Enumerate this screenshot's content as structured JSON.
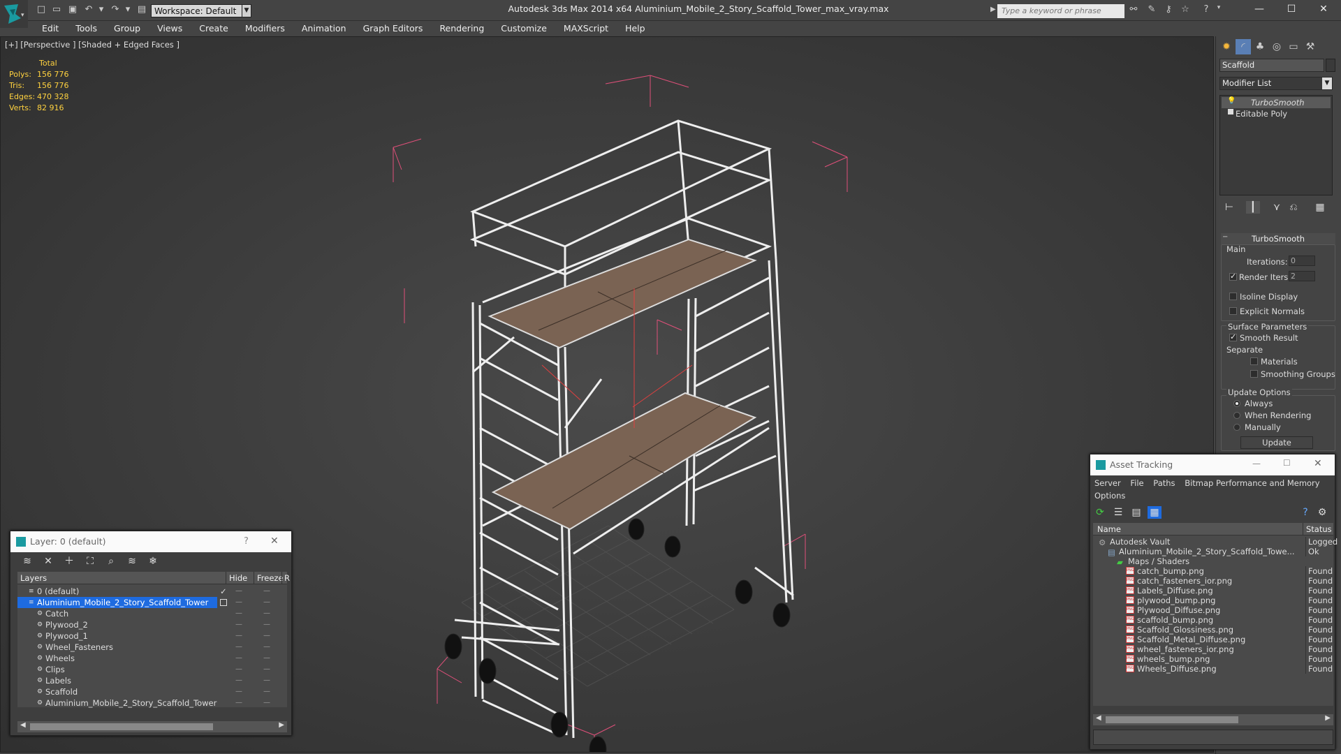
{
  "app": {
    "title": "Autodesk 3ds Max  2014 x64     Aluminium_Mobile_2_Story_Scaffold_Tower_max_vray.max",
    "workspace": "Workspace: Default",
    "search_placeholder": "Type a keyword or phrase"
  },
  "menu": [
    "Edit",
    "Tools",
    "Group",
    "Views",
    "Create",
    "Modifiers",
    "Animation",
    "Graph Editors",
    "Rendering",
    "Customize",
    "MAXScript",
    "Help"
  ],
  "viewport": {
    "label": "[+] [Perspective ] [Shaded + Edged Faces ]",
    "stats": {
      "header": "Total",
      "rows": [
        {
          "label": "Polys:",
          "value": "156 776"
        },
        {
          "label": "Tris:",
          "value": "156 776"
        },
        {
          "label": "Edges:",
          "value": "470 328"
        },
        {
          "label": "Verts:",
          "value": "82 916"
        }
      ]
    }
  },
  "command_panel": {
    "object_name": "Scaffold",
    "modifier_list": "Modifier List",
    "stack": [
      "TurboSmooth",
      "Editable Poly"
    ],
    "rollout_title": "TurboSmooth",
    "main_label": "Main",
    "iterations_label": "Iterations:",
    "iterations_value": "0",
    "render_iters_label": "Render Iters:",
    "render_iters_value": "2",
    "isoline": "Isoline Display",
    "explicit": "Explicit Normals",
    "surface_params": "Surface Parameters",
    "smooth_result": "Smooth Result",
    "separate": "Separate",
    "materials": "Materials",
    "smoothing_groups": "Smoothing Groups",
    "update_options": "Update Options",
    "always": "Always",
    "when_rendering": "When Rendering",
    "manually": "Manually",
    "update_btn": "Update"
  },
  "layer_panel": {
    "title": "Layer: 0 (default)",
    "help": "?",
    "col_layers": "Layers",
    "col_hide": "Hide",
    "col_freeze": "Freeze",
    "col_r": "R",
    "rows": [
      {
        "name": "0 (default)",
        "level": 1
      },
      {
        "name": "Aluminium_Mobile_2_Story_Scaffold_Tower",
        "level": 1
      },
      {
        "name": "Catch",
        "level": 2
      },
      {
        "name": "Plywood_2",
        "level": 2
      },
      {
        "name": "Plywood_1",
        "level": 2
      },
      {
        "name": "Wheel_Fasteners",
        "level": 2
      },
      {
        "name": "Wheels",
        "level": 2
      },
      {
        "name": "Clips",
        "level": 2
      },
      {
        "name": "Labels",
        "level": 2
      },
      {
        "name": "Scaffold",
        "level": 2
      },
      {
        "name": "Aluminium_Mobile_2_Story_Scaffold_Tower",
        "level": 2
      }
    ]
  },
  "asset_panel": {
    "title": "Asset Tracking",
    "menus": [
      "Server",
      "File",
      "Paths",
      "Bitmap Performance and Memory"
    ],
    "options": "Options",
    "col_name": "Name",
    "col_status": "Status",
    "rows": [
      {
        "name": "Autodesk Vault",
        "status": "Logged",
        "level": 1,
        "kind": "vault"
      },
      {
        "name": "Aluminium_Mobile_2_Story_Scaffold_Towe...",
        "status": "Ok",
        "level": 2,
        "kind": "file"
      },
      {
        "name": "Maps / Shaders",
        "status": "",
        "level": 3,
        "kind": "folder"
      },
      {
        "name": "catch_bump.png",
        "status": "Found",
        "level": 4,
        "kind": "png"
      },
      {
        "name": "catch_fasteners_ior.png",
        "status": "Found",
        "level": 4,
        "kind": "png"
      },
      {
        "name": "Labels_Diffuse.png",
        "status": "Found",
        "level": 4,
        "kind": "png"
      },
      {
        "name": "plywood_bump.png",
        "status": "Found",
        "level": 4,
        "kind": "png"
      },
      {
        "name": "Plywood_Diffuse.png",
        "status": "Found",
        "level": 4,
        "kind": "png"
      },
      {
        "name": "scaffold_bump.png",
        "status": "Found",
        "level": 4,
        "kind": "png"
      },
      {
        "name": "Scaffold_Glossiness.png",
        "status": "Found",
        "level": 4,
        "kind": "png"
      },
      {
        "name": "Scaffold_Metal_Diffuse.png",
        "status": "Found",
        "level": 4,
        "kind": "png"
      },
      {
        "name": "wheel_fasteners_ior.png",
        "status": "Found",
        "level": 4,
        "kind": "png"
      },
      {
        "name": "wheels_bump.png",
        "status": "Found",
        "level": 4,
        "kind": "png"
      },
      {
        "name": "Wheels_Diffuse.png",
        "status": "Found",
        "level": 4,
        "kind": "png"
      }
    ]
  },
  "colors": {
    "selection": "#1e6be0",
    "stats": "#ffd23f",
    "bbox": "#e0507a"
  }
}
